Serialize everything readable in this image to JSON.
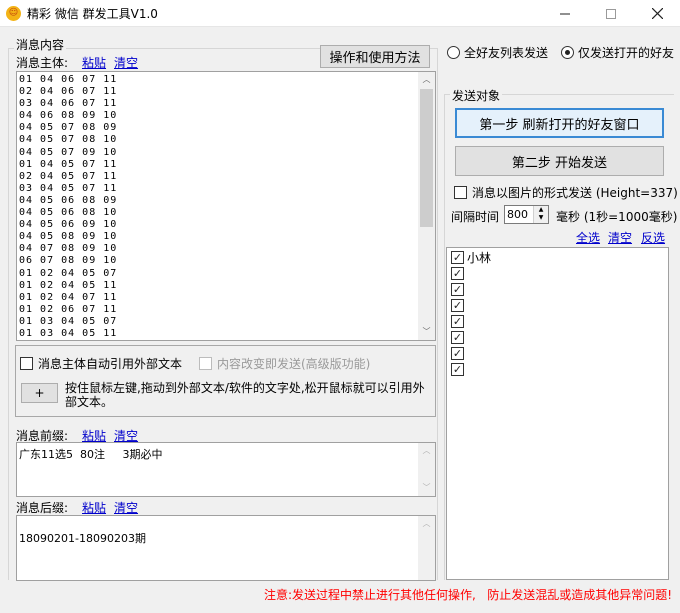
{
  "window": {
    "title": "精彩 微信 群发工具V1.0",
    "icon_glyph": "☺"
  },
  "left": {
    "group_title": "消息内容",
    "body_label": "消息主体:",
    "paste": "粘贴",
    "clear": "清空",
    "help_button": "操作和使用方法",
    "body_lines": [
      "01 04 06 07 11",
      "02 04 06 07 11",
      "03 04 06 07 11",
      "04 06 08 09 10",
      "04 05 07 08 09",
      "04 05 07 08 10",
      "04 05 07 09 10",
      "01 04 05 07 11",
      "02 04 05 07 11",
      "03 04 05 07 11",
      "04 05 06 08 09",
      "04 05 06 08 10",
      "04 05 06 09 10",
      "04 05 08 09 10",
      "04 07 08 09 10",
      "06 07 08 09 10",
      "01 02 04 05 07",
      "01 02 04 05 11",
      "01 02 04 07 11",
      "01 02 06 07 11",
      "01 03 04 05 07",
      "01 03 04 05 11"
    ],
    "auto_ref_label": "消息主体自动引用外部文本",
    "send_on_change_label": "内容改变即发送(高级版功能)",
    "plus_button": "+",
    "drag_hint": "按住鼠标左键,拖动到外部文本/软件的文字处,松开鼠标就可以引用外部文本。",
    "prefix_label": "消息前缀:",
    "prefix_value": "广东11选5  80注     3期必中",
    "suffix_label": "消息后缀:",
    "suffix_value": "18090201-18090203期"
  },
  "right": {
    "radio_all": "全好友列表发送",
    "radio_open": "仅发送打开的好友",
    "group_title": "发送对象",
    "step1_button": "第一步     刷新打开的好友窗口",
    "step2_button": "第二步     开始发送",
    "image_mode_label": "消息以图片的形式发送 (Height=337)",
    "interval_label": "间隔时间",
    "interval_value": "800",
    "interval_unit": "毫秒 (1秒=1000毫秒)",
    "select_all": "全选",
    "clear": "清空",
    "invert": "反选",
    "friends": [
      {
        "name": "小林",
        "checked": true
      },
      {
        "name": "",
        "checked": true
      },
      {
        "name": "",
        "checked": true
      },
      {
        "name": "",
        "checked": true
      },
      {
        "name": "",
        "checked": true
      },
      {
        "name": "",
        "checked": true
      },
      {
        "name": "",
        "checked": true
      },
      {
        "name": "",
        "checked": true
      }
    ]
  },
  "footer": {
    "warning": "注意:发送过程中禁止进行其他任何操作,   防止发送混乱或造成其他异常问题!"
  },
  "colors": {
    "warning": "#ff0000",
    "link": "#0000cc",
    "primary_border": "#3a8ad4"
  }
}
